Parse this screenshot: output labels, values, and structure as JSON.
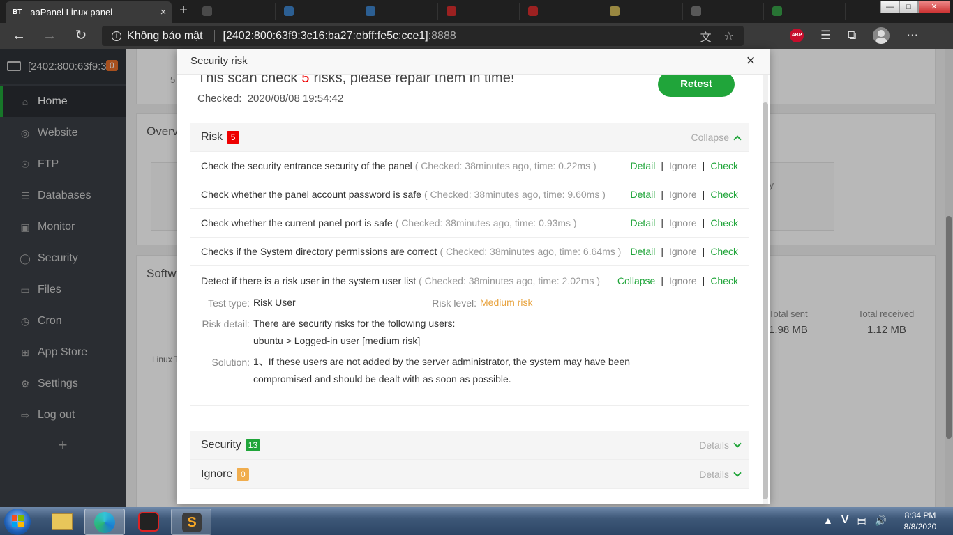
{
  "browser": {
    "tab_favicon": "BT",
    "tab_title": "aaPanel Linux panel",
    "tab_close": "×",
    "new_tab": "+",
    "security_label": "Không bảo mật",
    "url_host": "[2402:800:63f9:3c16:ba27:ebff:fe5c:cce1]",
    "url_port": ":8888",
    "abp": "ABP"
  },
  "sidebar": {
    "host": "[2402:800:63f9:3c",
    "host_badge": "0",
    "items": [
      {
        "label": "Home",
        "icon": "home-icon"
      },
      {
        "label": "Website",
        "icon": "globe-icon"
      },
      {
        "label": "FTP",
        "icon": "ftp-icon"
      },
      {
        "label": "Databases",
        "icon": "database-icon"
      },
      {
        "label": "Monitor",
        "icon": "monitor-icon"
      },
      {
        "label": "Security",
        "icon": "shield-icon"
      },
      {
        "label": "Files",
        "icon": "folder-icon"
      },
      {
        "label": "Cron",
        "icon": "clock-icon"
      },
      {
        "label": "App Store",
        "icon": "grid-icon"
      },
      {
        "label": "Settings",
        "icon": "gear-icon"
      },
      {
        "label": "Log out",
        "icon": "logout-icon"
      }
    ],
    "add": "+"
  },
  "background": {
    "overview_heading": "Overv",
    "software_heading": "Softw",
    "total_sent_label": "Total sent",
    "total_sent_value": "1.98 MB",
    "total_received_label": "Total received",
    "total_received_value": "1.12 MB",
    "linux_label": "Linux T",
    "partial_5": "5",
    "partial_y": "y"
  },
  "modal": {
    "title": "Security risk",
    "close": "×",
    "scan_prefix": "This scan check",
    "scan_count": "5",
    "scan_suffix": "risks, please repair them in time!",
    "checked_label": "Checked:",
    "checked_time": "2020/08/08 19:54:42",
    "retest": "Retest",
    "risk_section": {
      "label": "Risk",
      "count": "5",
      "toggle": "Collapse"
    },
    "risks": [
      {
        "name": "Check the security entrance security of the panel",
        "meta": "( Checked: 38minutes ago, time: 0.22ms )",
        "first_action": "Detail"
      },
      {
        "name": "Check whether the panel account password is safe",
        "meta": "( Checked: 38minutes ago, time: 9.60ms )",
        "first_action": "Detail"
      },
      {
        "name": "Check whether the current panel port is safe",
        "meta": "( Checked: 38minutes ago, time: 0.93ms )",
        "first_action": "Detail"
      },
      {
        "name": "Checks if the System directory permissions are correct",
        "meta": "( Checked: 38minutes ago, time: 6.64ms )",
        "first_action": "Detail"
      },
      {
        "name": "Detect if there is a risk user in the system user list",
        "meta": "( Checked: 38minutes ago, time: 2.02ms )",
        "first_action": "Collapse"
      }
    ],
    "action_ignore": "Ignore",
    "action_check": "Check",
    "action_sep": "|",
    "detail": {
      "test_type_label": "Test type:",
      "test_type": "Risk User",
      "risk_level_label": "Risk level:",
      "risk_level": "Medium risk",
      "risk_detail_label": "Risk detail:",
      "risk_detail_1": "There are security risks for the following users:",
      "risk_detail_2": "ubuntu > Logged-in user [medium risk]",
      "solution_label": "Solution:",
      "solution_1": "1、If these users are not added by the server administrator, the system may have been",
      "solution_2": "compromised and should be dealt with as soon as possible."
    },
    "security_section": {
      "label": "Security",
      "count": "13",
      "toggle": "Details"
    },
    "ignore_section": {
      "label": "Ignore",
      "count": "0",
      "toggle": "Details"
    }
  },
  "taskbar": {
    "lang": "V",
    "time": "8:34 PM",
    "date": "8/8/2020"
  },
  "colors": {
    "accent_green": "#20a53a",
    "risk_red": "#e00",
    "medium_orange": "#e8a33e",
    "ignore_badge": "#f0ad4e"
  }
}
